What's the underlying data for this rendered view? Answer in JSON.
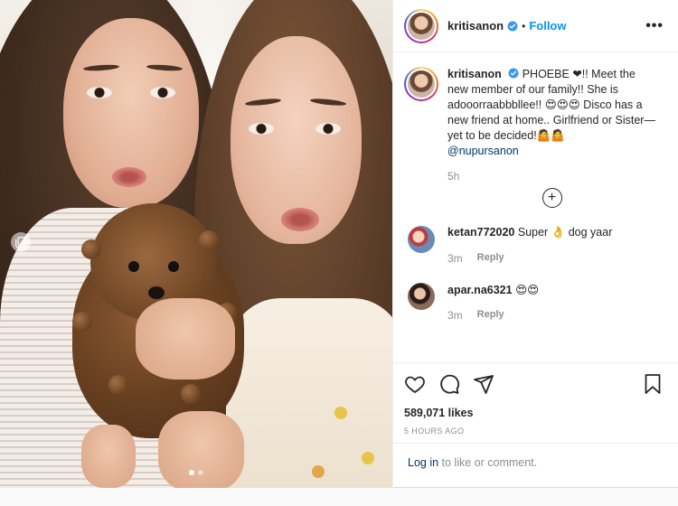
{
  "post": {
    "username": "kritisanon",
    "follow_label": "Follow",
    "more_label": "•••",
    "separator": "•"
  },
  "caption": {
    "username": "kritisanon",
    "text": "PHOEBE ❤!! Meet the new member of our family!! She is adooorraabbbllee!! 😍😍😍 Disco has a new friend at home.. Girlfriend or Sister— yet to be decided!🤷🤷",
    "mention": "@nupursanon",
    "time": "5h"
  },
  "comments": [
    {
      "username": "ketan772020",
      "text": "Super 👌 dog yaar",
      "time": "3m",
      "reply_label": "Reply"
    },
    {
      "username": "apar.na6321",
      "text": "😍😍",
      "time": "3m",
      "reply_label": "Reply"
    }
  ],
  "actions": {
    "icons": [
      "heart-icon",
      "comment-icon",
      "share-icon",
      "bookmark-icon"
    ]
  },
  "likes": "589,071 likes",
  "posted_ago": "5 HOURS AGO",
  "login": {
    "link_label": "Log in",
    "rest": " to like or comment."
  },
  "carousel": {
    "slides": 2,
    "active_index": 0
  },
  "colors": {
    "link_blue": "#0095f6",
    "mention_blue": "#00376b",
    "muted": "#8e8e8e",
    "verified": "#3897f0"
  }
}
